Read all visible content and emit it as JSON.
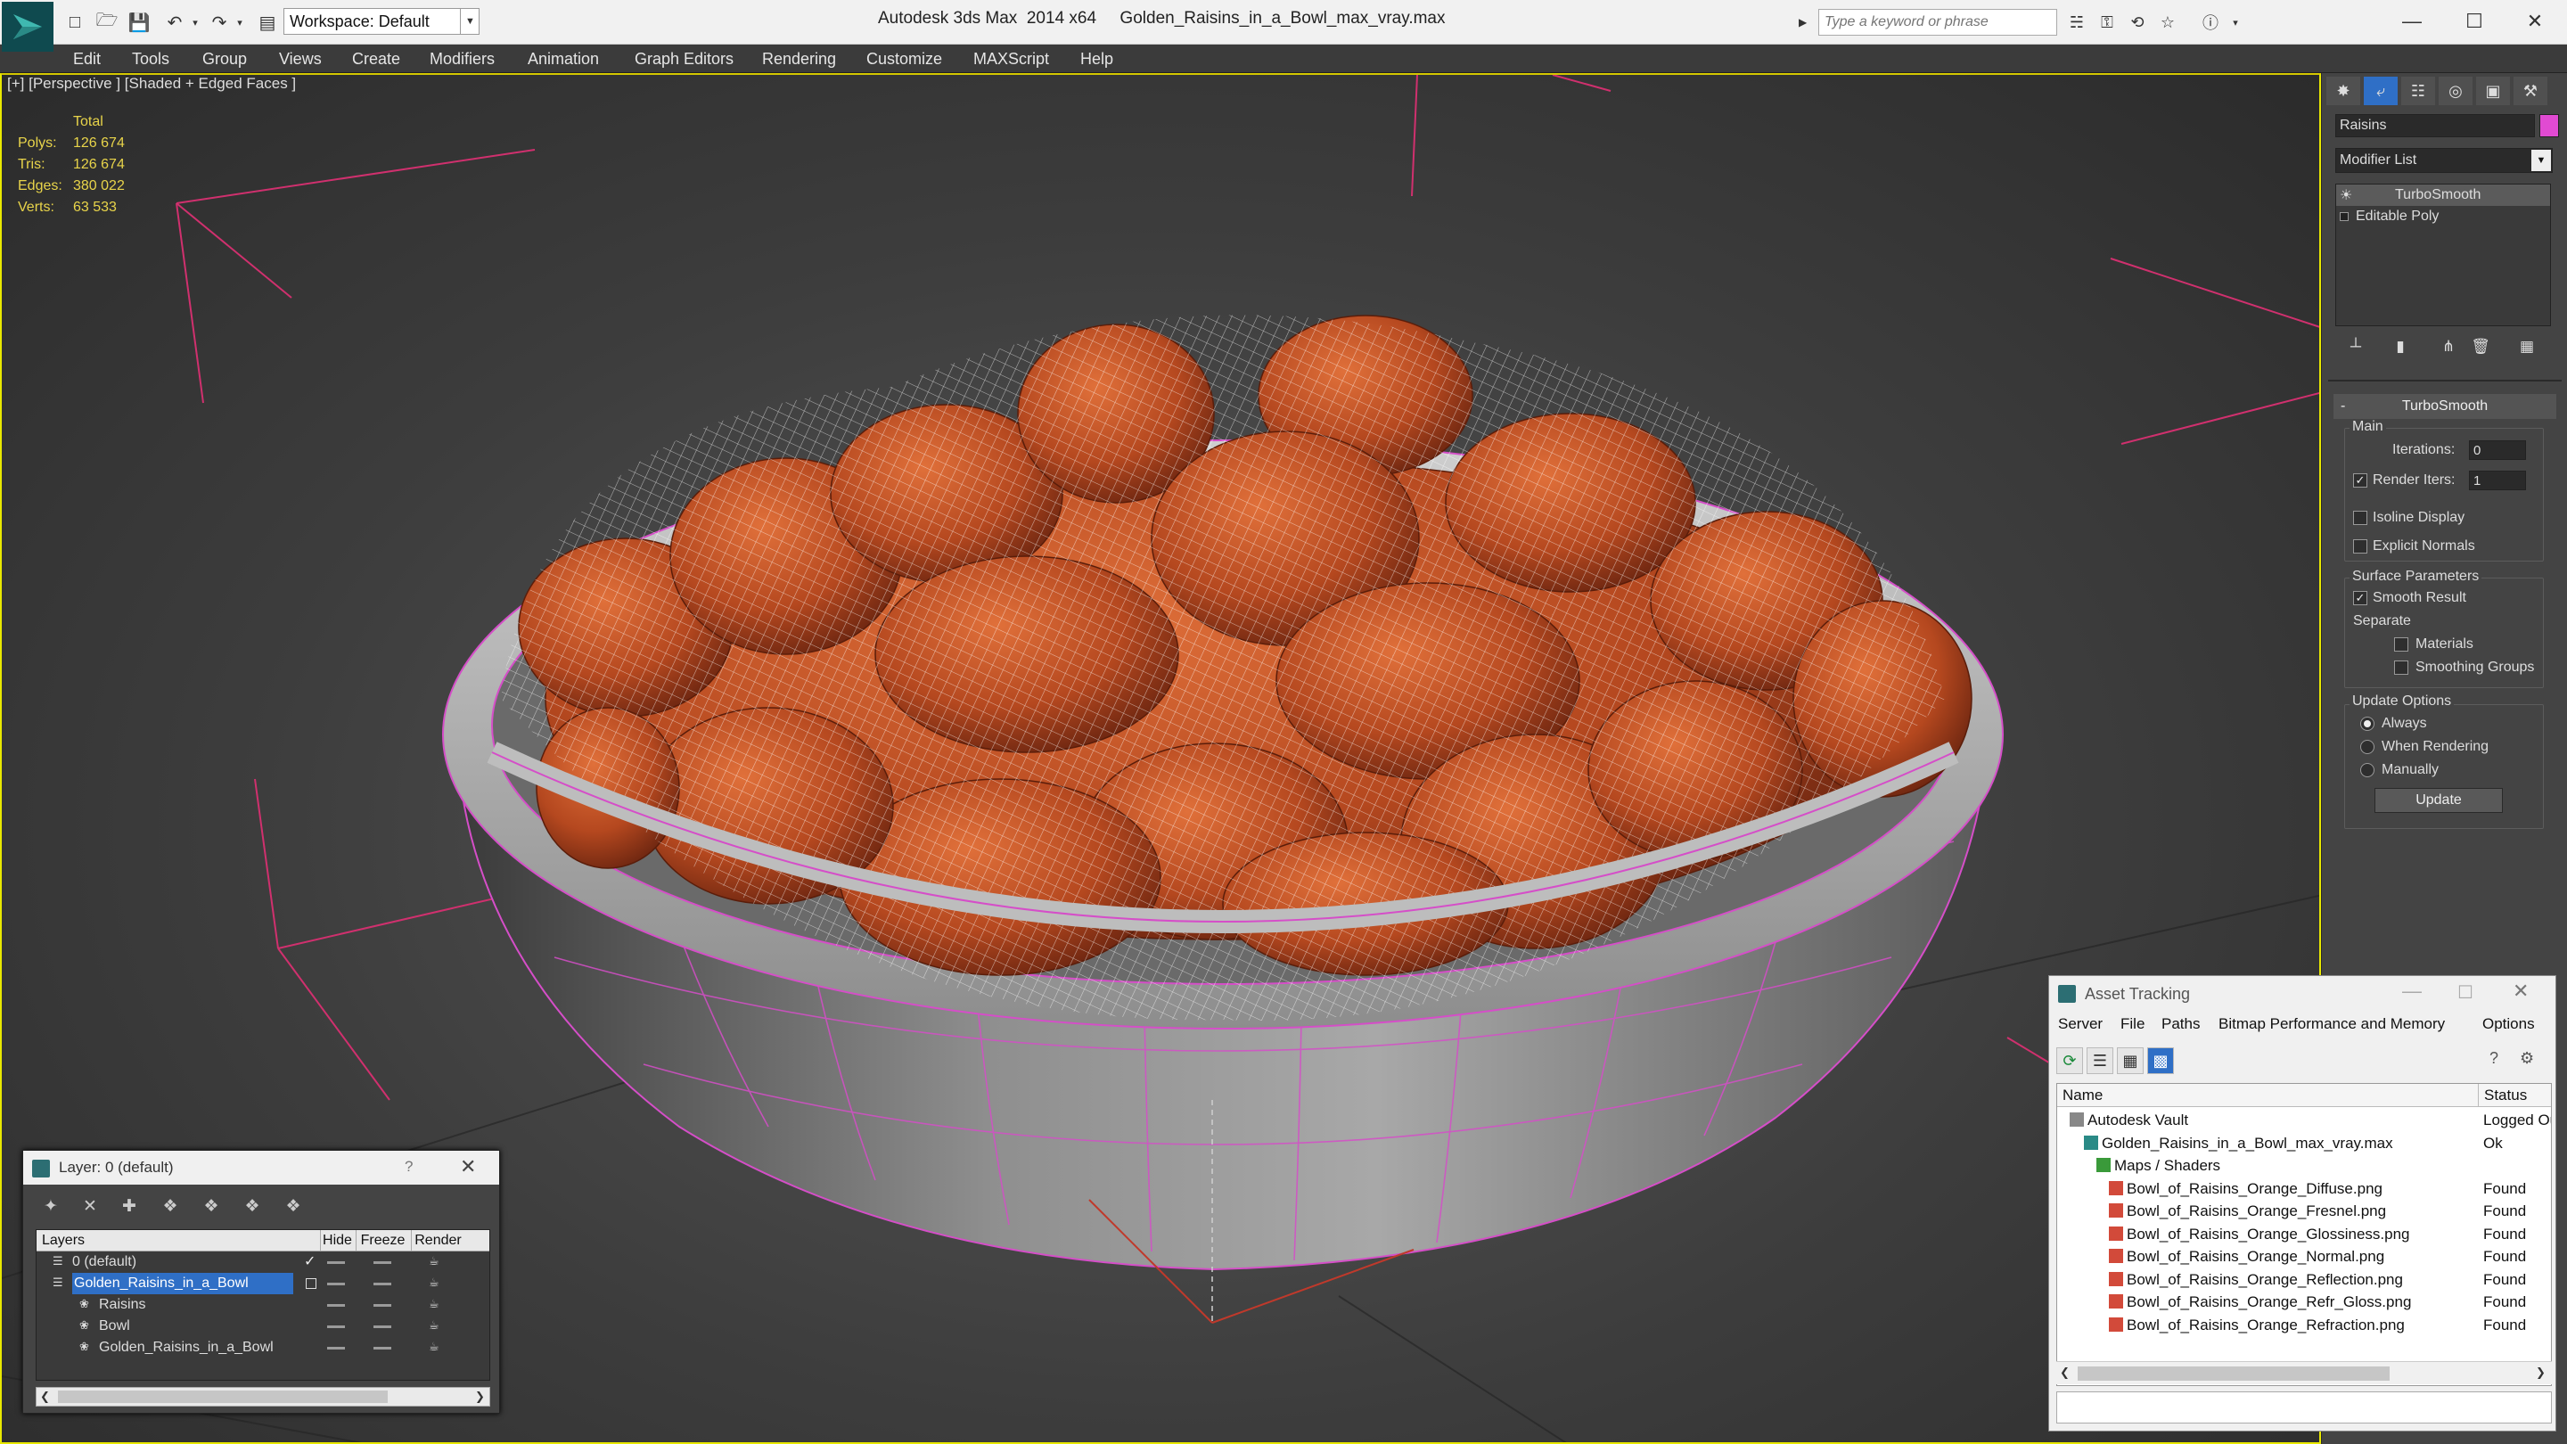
{
  "window": {
    "title": "Autodesk 3ds Max  2014 x64     Golden_Raisins_in_a_Bowl_max_vray.max",
    "workspace": "Workspace: Default",
    "search_placeholder": "Type a keyword or phrase"
  },
  "menu": [
    "Edit",
    "Tools",
    "Group",
    "Views",
    "Create",
    "Modifiers",
    "Animation",
    "Graph Editors",
    "Rendering",
    "Customize",
    "MAXScript",
    "Help"
  ],
  "viewport": {
    "label": "[+] [Perspective ] [Shaded + Edged Faces ]",
    "stats": {
      "header": "Total",
      "rows": [
        {
          "label": "Polys:",
          "value": "126 674"
        },
        {
          "label": "Tris:",
          "value": "126 674"
        },
        {
          "label": "Edges:",
          "value": "380 022"
        },
        {
          "label": "Verts:",
          "value": "63 533"
        }
      ]
    }
  },
  "command_panel": {
    "object_name": "Raisins",
    "object_color": "#e14ad2",
    "modifier_list": "Modifier List",
    "stack": [
      "TurboSmooth",
      "Editable Poly"
    ],
    "rollout_title": "TurboSmooth",
    "main": {
      "group": "Main",
      "iterations_label": "Iterations:",
      "iterations_value": "0",
      "render_iters_label": "Render Iters:",
      "render_iters_value": "1",
      "render_iters_checked": true,
      "isoline": "Isoline Display",
      "explicit": "Explicit Normals"
    },
    "surface": {
      "group": "Surface Parameters",
      "smooth_result": "Smooth Result",
      "separate": "Separate",
      "materials": "Materials",
      "smoothing_groups": "Smoothing Groups"
    },
    "update": {
      "group": "Update Options",
      "always": "Always",
      "when_rendering": "When Rendering",
      "manually": "Manually",
      "button": "Update"
    }
  },
  "layer_dialog": {
    "title": "Layer: 0 (default)",
    "help": "?",
    "columns": {
      "layers": "Layers",
      "hide": "Hide",
      "freeze": "Freeze",
      "render": "Render"
    },
    "rows": [
      {
        "name": "0 (default)",
        "indent": 0
      },
      {
        "name": "Golden_Raisins_in_a_Bowl",
        "indent": 0
      },
      {
        "name": "Raisins",
        "indent": 1
      },
      {
        "name": "Bowl",
        "indent": 1
      },
      {
        "name": "Golden_Raisins_in_a_Bowl",
        "indent": 1
      }
    ]
  },
  "asset_tracking": {
    "title": "Asset Tracking",
    "menu": [
      "Server",
      "File",
      "Paths",
      "Bitmap Performance and Memory",
      "Options"
    ],
    "columns": {
      "name": "Name",
      "status": "Status"
    },
    "rows": [
      {
        "name": "Autodesk Vault",
        "status": "Logged Ou",
        "indent": 0
      },
      {
        "name": "Golden_Raisins_in_a_Bowl_max_vray.max",
        "status": "Ok",
        "indent": 1
      },
      {
        "name": "Maps / Shaders",
        "status": "",
        "indent": 2
      },
      {
        "name": "Bowl_of_Raisins_Orange_Diffuse.png",
        "status": "Found",
        "indent": 3
      },
      {
        "name": "Bowl_of_Raisins_Orange_Fresnel.png",
        "status": "Found",
        "indent": 3
      },
      {
        "name": "Bowl_of_Raisins_Orange_Glossiness.png",
        "status": "Found",
        "indent": 3
      },
      {
        "name": "Bowl_of_Raisins_Orange_Normal.png",
        "status": "Found",
        "indent": 3
      },
      {
        "name": "Bowl_of_Raisins_Orange_Reflection.png",
        "status": "Found",
        "indent": 3
      },
      {
        "name": "Bowl_of_Raisins_Orange_Refr_Gloss.png",
        "status": "Found",
        "indent": 3
      },
      {
        "name": "Bowl_of_Raisins_Orange_Refraction.png",
        "status": "Found",
        "indent": 3
      }
    ]
  }
}
